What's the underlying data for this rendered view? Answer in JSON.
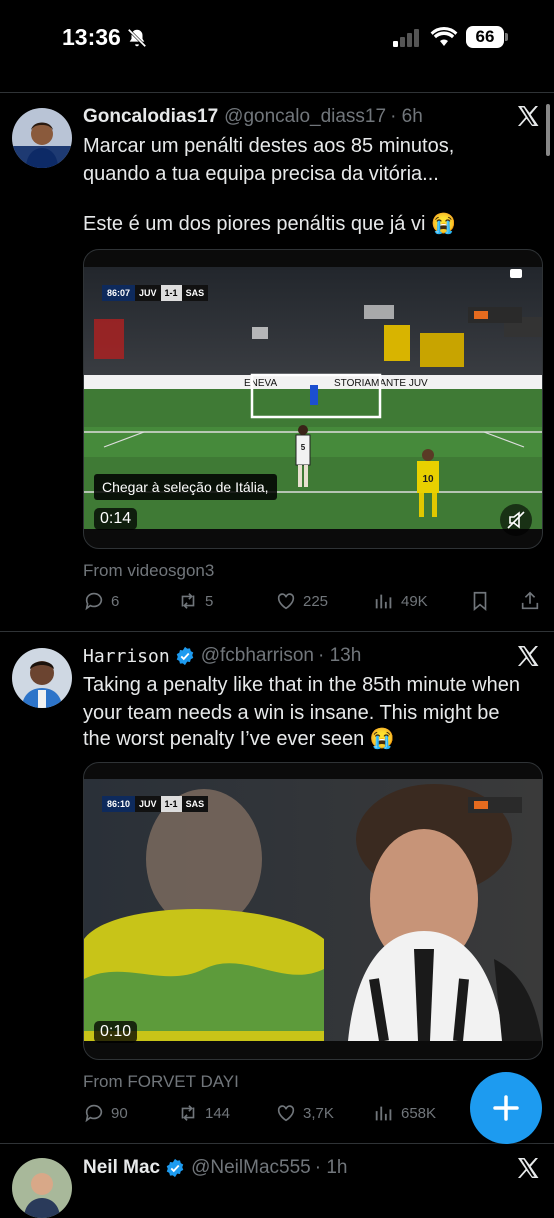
{
  "status_bar": {
    "time": "13:36",
    "battery": "66"
  },
  "tweets": [
    {
      "display_name": "Goncalodias17",
      "handle": "@goncalo_diass17",
      "age": "· 6h",
      "text_line1": "Marcar um penálti destes aos 85 minutos,",
      "text_line2": "quando a tua equipa precisa da vitória...",
      "text_line3": "Este é um dos piores penáltis que já vi 😭",
      "video": {
        "duration": "0:14",
        "caption": "Chegar à seleção de Itália,",
        "scorebug": {
          "clock": "86:07",
          "home": "JUV",
          "score": "1-1",
          "away": "SAS"
        },
        "banner_left": "ENEVA",
        "banner_right": "STORIAMANTE JUV",
        "player_left": "5",
        "player_right": "10"
      },
      "from": "From videosgon3",
      "replies": "6",
      "reposts": "5",
      "likes": "225",
      "views": "49K"
    },
    {
      "display_name": "Harrison",
      "handle": "@fcbharrison",
      "age": "· 13h",
      "text_line1": "Taking a penalty like that in the 85th minute when",
      "text_line2": "your team needs a win is insane. This might be",
      "text_line3": "the worst penalty I’ve ever seen 😭",
      "video": {
        "duration": "0:10",
        "scorebug": {
          "clock": "86:10",
          "home": "JUV",
          "score": "1-1",
          "away": "SAS"
        }
      },
      "from": "From FORVET DAYI",
      "replies": "90",
      "reposts": "144",
      "likes": "3,7K",
      "views": "658K"
    },
    {
      "display_name": "Neil Mac",
      "handle": "@NeilMac555",
      "age": "· 1h"
    }
  ],
  "icons": [
    "bell-slash-icon",
    "signal-icon",
    "wifi-icon",
    "x-logo-icon",
    "verified-badge-icon",
    "reply-icon",
    "repost-icon",
    "like-icon",
    "views-icon",
    "bookmark-icon",
    "share-icon",
    "compose-plus-icon",
    "mute-icon",
    "cc-icon"
  ],
  "colors": {
    "background": "#000000",
    "text": "#e7e9ea",
    "muted": "#71767b",
    "accent": "#1d9bf0",
    "divider": "#2f3336"
  }
}
